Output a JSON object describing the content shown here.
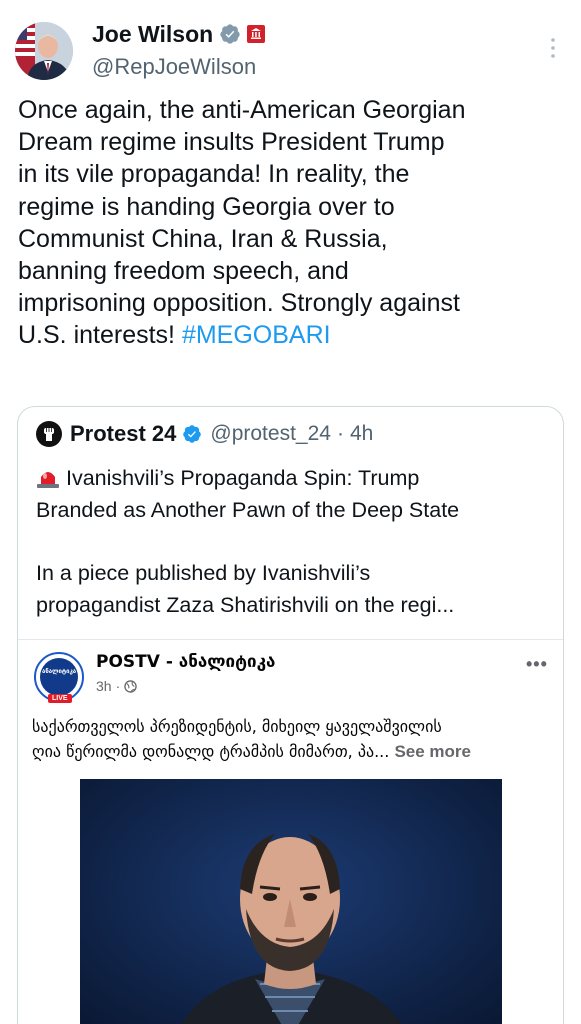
{
  "tweet": {
    "author_name": "Joe Wilson",
    "author_handle": "@RepJoeWilson",
    "text_lines": [
      "Once again, the anti-American Georgian",
      "Dream regime insults President Trump",
      "in its vile propaganda! In reality, the",
      "regime is handing Georgia over to",
      "Communist China, Iran & Russia,",
      "banning freedom speech, and",
      "imprisoning opposition. Strongly against",
      "U.S. interests! "
    ],
    "hashtag": "#MEGOBARI"
  },
  "quote": {
    "name": "Protest 24",
    "handle": "@protest_24",
    "separator": "·",
    "time": "4h",
    "line1": "Ivanishvili’s Propaganda Spin: Trump",
    "line2": "Branded as Another Pawn of the Deep State",
    "line3": "In a piece published by Ivanishvili’s",
    "line4": "propagandist Zaza Shatirishvili on the regi..."
  },
  "facebook_post": {
    "page_name": "POSTV - ანალიტიკა",
    "time": "3h",
    "dot": "·",
    "logo_text": "ანალიტიკა",
    "live_badge": "LIVE",
    "caption_line1": "საქართველოს პრეზიდენტის, მიხეილ ყაველაშვილის",
    "caption_line2": "ღია წერილმა დონალდ ტრამპის მიმართ, პა...",
    "see_more": "See more"
  },
  "colors": {
    "link": "#1d9bf0",
    "verified": "#829aab",
    "gov_badge": "#d4202a",
    "text": "#0f1419",
    "muted": "#536471"
  },
  "icons": [
    "verified-badge-icon",
    "government-badge-icon",
    "more-vertical-icon",
    "protest-fist-icon",
    "siren-emoji-icon",
    "more-horizontal-icon",
    "globe-icon"
  ]
}
